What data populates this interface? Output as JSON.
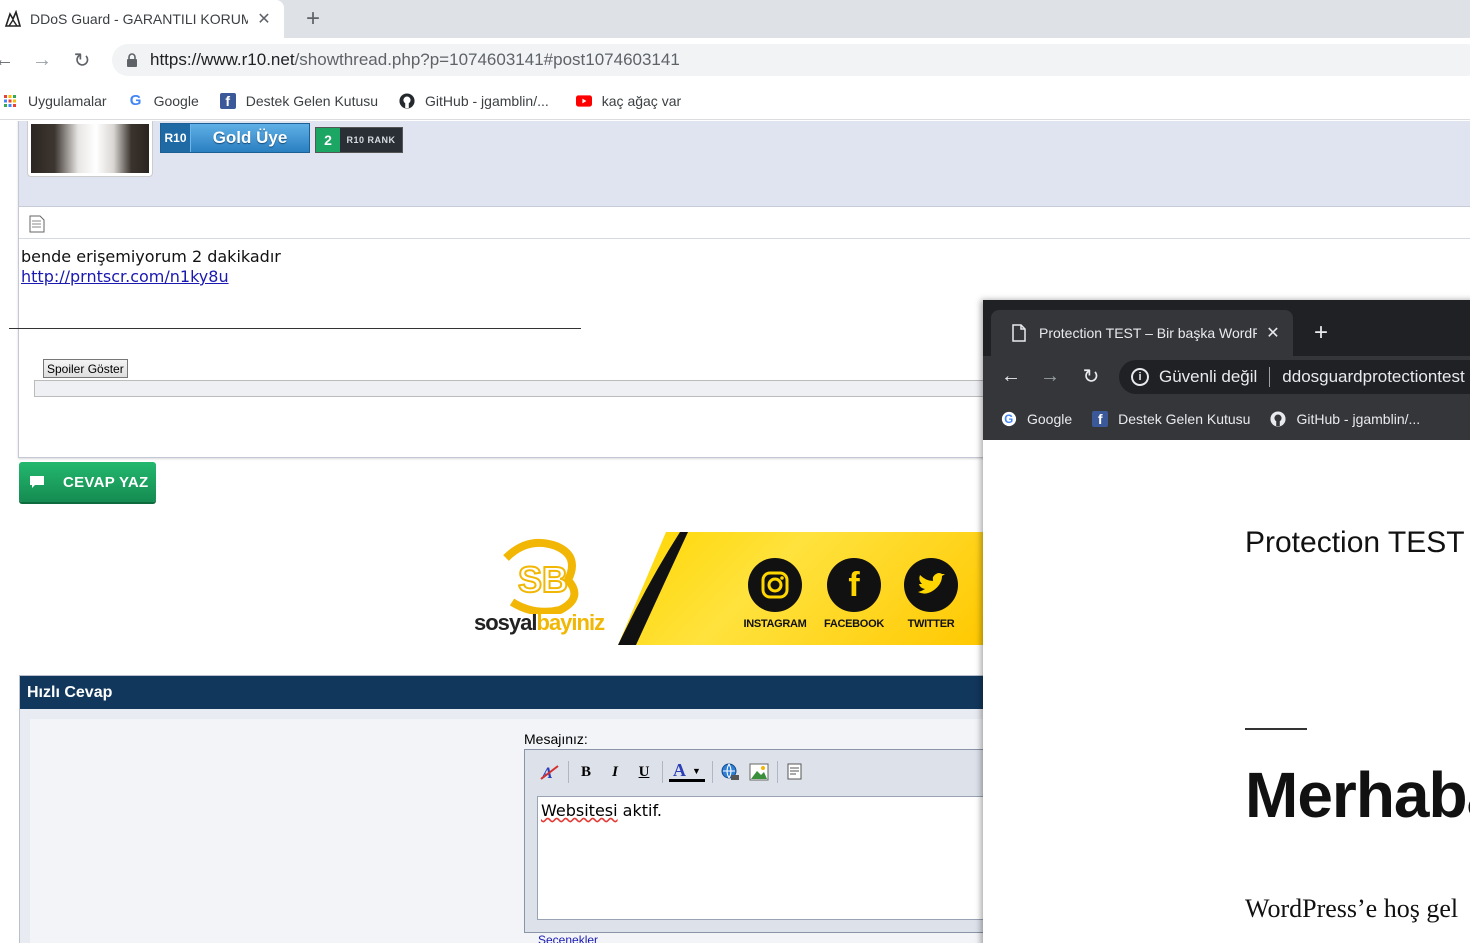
{
  "back_window": {
    "tab": {
      "title": "DDoS Guard - GARANTILI KORUMA",
      "close": "✕"
    },
    "new_tab": "+",
    "url": {
      "host": "https://www.r10.net",
      "path": "/showthread.php?p=1074603141#post1074603141"
    },
    "bookmarks": [
      {
        "label": "Uygulamalar",
        "icon": "apps-grid-icon"
      },
      {
        "label": "Google",
        "icon": "google-icon"
      },
      {
        "label": "Destek Gelen Kutusu",
        "icon": "facebook-icon"
      },
      {
        "label": "GitHub - jgamblin/...",
        "icon": "github-icon"
      },
      {
        "label": "kaç ağaç var",
        "icon": "youtube-icon"
      }
    ]
  },
  "post": {
    "badge_prefix": "R10",
    "badge_level": "Gold Üye",
    "rank_number": "2",
    "rank_text": "R10 RANK",
    "message_line": "bende erişemiyorum 2 dakikadır",
    "message_link": "http://prntscr.com/n1ky8u",
    "signature_rule": "____________________________________________________",
    "spoiler_button": "Spoiler Göster"
  },
  "reply_button": "CEVAP YAZ",
  "banner": {
    "brand_dark": "sosyal",
    "brand_yellow": "bayiniz",
    "social": [
      {
        "label": "INSTAGRAM",
        "icon": "instagram-icon"
      },
      {
        "label": "FACEBOOK",
        "icon": "facebook-icon"
      },
      {
        "label": "TWITTER",
        "icon": "twitter-icon"
      }
    ]
  },
  "quick_reply": {
    "title": "Hızlı Cevap",
    "message_label": "Mesajınız:",
    "editor_text_word": "Websitesi",
    "editor_text_rest": " aktif.",
    "options_label": "Seçenekler",
    "toolbar": {
      "bold": "B",
      "italic": "I",
      "underline": "U",
      "color": "A"
    }
  },
  "front_window": {
    "tab": {
      "title": "Protection TEST – Bir başka WordPress sitesi",
      "close": "✕"
    },
    "new_tab": "+",
    "security": "Güvenli değil",
    "domain": "ddosguardprotectiontest",
    "bookmarks": [
      {
        "label": "Google",
        "icon": "google-icon"
      },
      {
        "label": "Destek Gelen Kutusu",
        "icon": "facebook-icon"
      },
      {
        "label": "GitHub - jgamblin/...",
        "icon": "github-icon"
      }
    ],
    "site_title": "Protection TEST –",
    "post_heading": "Merhaba",
    "post_excerpt": "WordPress’e hoş gel"
  }
}
